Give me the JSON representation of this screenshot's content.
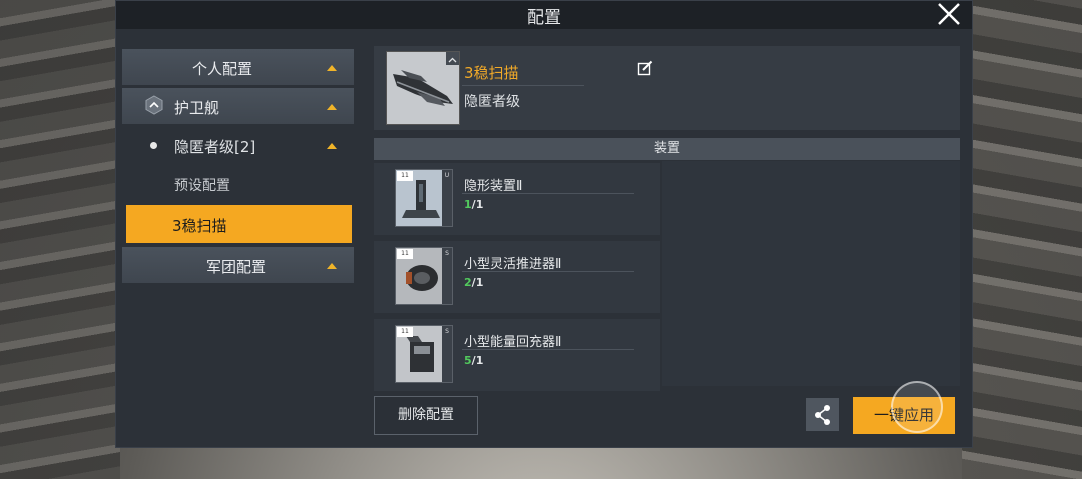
{
  "dialog": {
    "title": "配置"
  },
  "nav": {
    "personal": "个人配置",
    "frigate": "护卫舰",
    "stealth_class": "隐匿者级[2]",
    "preset": "预设配置",
    "active_fit": "3稳扫描",
    "corp": "军团配置"
  },
  "ship": {
    "name": "3稳扫描",
    "class": "隐匿者级"
  },
  "section": {
    "equipment": "装置"
  },
  "equipment": [
    {
      "name": "隐形装置Ⅱ",
      "have": "1",
      "need": "1",
      "tag": "11",
      "slot": "U"
    },
    {
      "name": "小型灵活推进器Ⅱ",
      "have": "2",
      "need": "1",
      "tag": "11",
      "slot": "S"
    },
    {
      "name": "小型能量回充器Ⅱ",
      "have": "5",
      "need": "1",
      "tag": "11",
      "slot": "S"
    }
  ],
  "actions": {
    "delete": "删除配置",
    "apply": "一键应用"
  },
  "colors": {
    "accent": "#f5a821",
    "have_qty": "#52c95d"
  },
  "icons": {
    "close": "close-icon",
    "edit": "edit-icon",
    "share": "share-icon",
    "hex": "hex-chevron-icon"
  }
}
